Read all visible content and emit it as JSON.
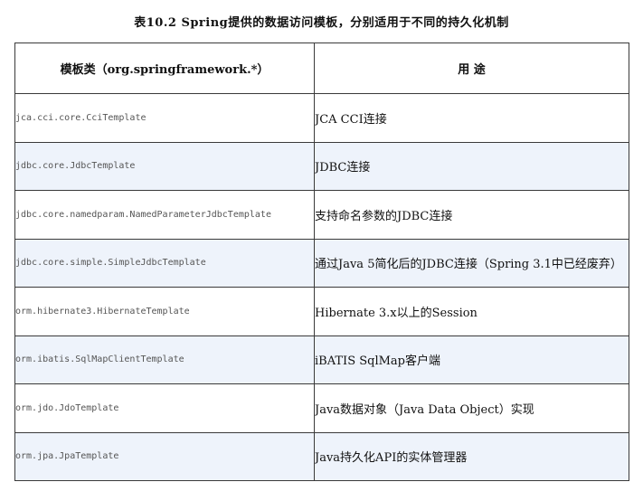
{
  "caption": "表10.2   Spring提供的数据访问模板，分别适用于不同的持久化机制",
  "table": {
    "headers": [
      "模板类（org.springframework.*）",
      "用   途"
    ],
    "rows": [
      {
        "class": "jca.cci.core.CciTemplate",
        "usage": "JCA CCI连接"
      },
      {
        "class": "jdbc.core.JdbcTemplate",
        "usage": "JDBC连接"
      },
      {
        "class": "jdbc.core.namedparam.NamedParameterJdbcTemplate",
        "usage": "支持命名参数的JDBC连接"
      },
      {
        "class": "jdbc.core.simple.SimpleJdbcTemplate",
        "usage": "通过Java 5简化后的JDBC连接（Spring 3.1中已经废弃）"
      },
      {
        "class": "orm.hibernate3.HibernateTemplate",
        "usage": "Hibernate 3.x以上的Session"
      },
      {
        "class": "orm.ibatis.SqlMapClientTemplate",
        "usage": "iBATIS SqlMap客户端"
      },
      {
        "class": "orm.jdo.JdoTemplate",
        "usage": "Java数据对象（Java Data Object）实现"
      },
      {
        "class": "orm.jpa.JpaTemplate",
        "usage": "Java持久化API的实体管理器"
      }
    ]
  }
}
